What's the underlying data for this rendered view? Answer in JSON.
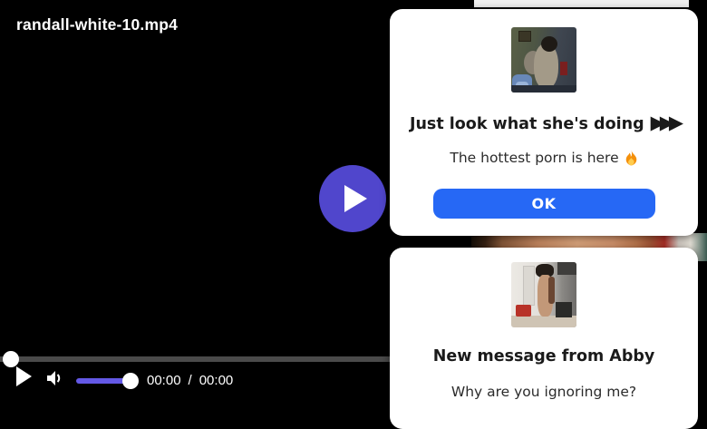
{
  "player": {
    "title": "randall-white-10.mp4",
    "current_time": "00:00",
    "time_separator": "/",
    "duration": "00:00"
  },
  "popups": [
    {
      "title": "Just look what she's doing",
      "title_arrows": "▶▶▶",
      "subtitle": "The hottest porn is here",
      "subtitle_emoji": "🔥",
      "button_label": "OK"
    },
    {
      "title": "New message from Abby",
      "subtitle": "Why are you ignoring me?"
    }
  ],
  "icons": {
    "big_play_icon": "play-triangle",
    "ctrl_play_icon": "play-triangle",
    "speaker_icon": "speaker-with-wave",
    "fire_icon": "flame"
  },
  "colors": {
    "play_button": "#5046cc",
    "volume_slider": "#6459e6",
    "ok_button": "#2668f5",
    "progress_track": "#4a4a4a",
    "popup_bg": "#ffffff"
  }
}
